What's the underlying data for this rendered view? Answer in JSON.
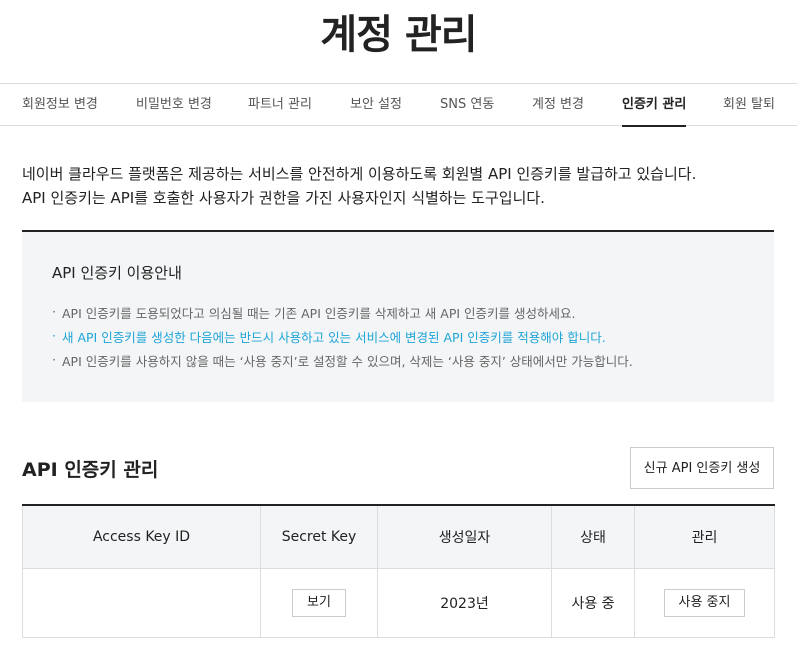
{
  "page": {
    "title": "계정 관리"
  },
  "tabs": [
    {
      "label": "회원정보 변경"
    },
    {
      "label": "비밀번호 변경"
    },
    {
      "label": "파트너 관리"
    },
    {
      "label": "보안 설정"
    },
    {
      "label": "SNS 연동"
    },
    {
      "label": "계정 변경"
    },
    {
      "label": "인증키 관리",
      "active": true
    },
    {
      "label": "회원 탈퇴"
    }
  ],
  "intro": {
    "line1": "네이버 클라우드 플랫폼은 제공하는 서비스를 안전하게 이용하도록 회원별 API 인증키를 발급하고 있습니다.",
    "line2": "API 인증키는 API를 호출한 사용자가 권한을 가진 사용자인지 식별하는 도구입니다."
  },
  "notice": {
    "title": "API 인증키 이용안내",
    "items": [
      "API 인증키를 도용되었다고 의심될 때는 기존 API 인증키를 삭제하고 새 API 인증키를 생성하세요.",
      "새 API 인증키를 생성한 다음에는 반드시 사용하고 있는 서비스에 변경된 API 인증키를 적용해야 합니다.",
      "API 인증키를 사용하지 않을 때는 ‘사용 중지’로 설정할 수 있으며, 삭제는 ‘사용 중지’ 상태에서만 가능합니다."
    ],
    "highlight_color": "#1fa5d6"
  },
  "key_section": {
    "title": "API 인증키 관리",
    "new_button": "신규 API 인증키 생성",
    "columns": [
      "Access Key ID",
      "Secret Key",
      "생성일자",
      "상태",
      "관리"
    ],
    "rows": [
      {
        "access_key_id": "",
        "secret_button": "보기",
        "created": "2023년",
        "status": "사용 중",
        "action_button": "사용 중지"
      }
    ]
  }
}
